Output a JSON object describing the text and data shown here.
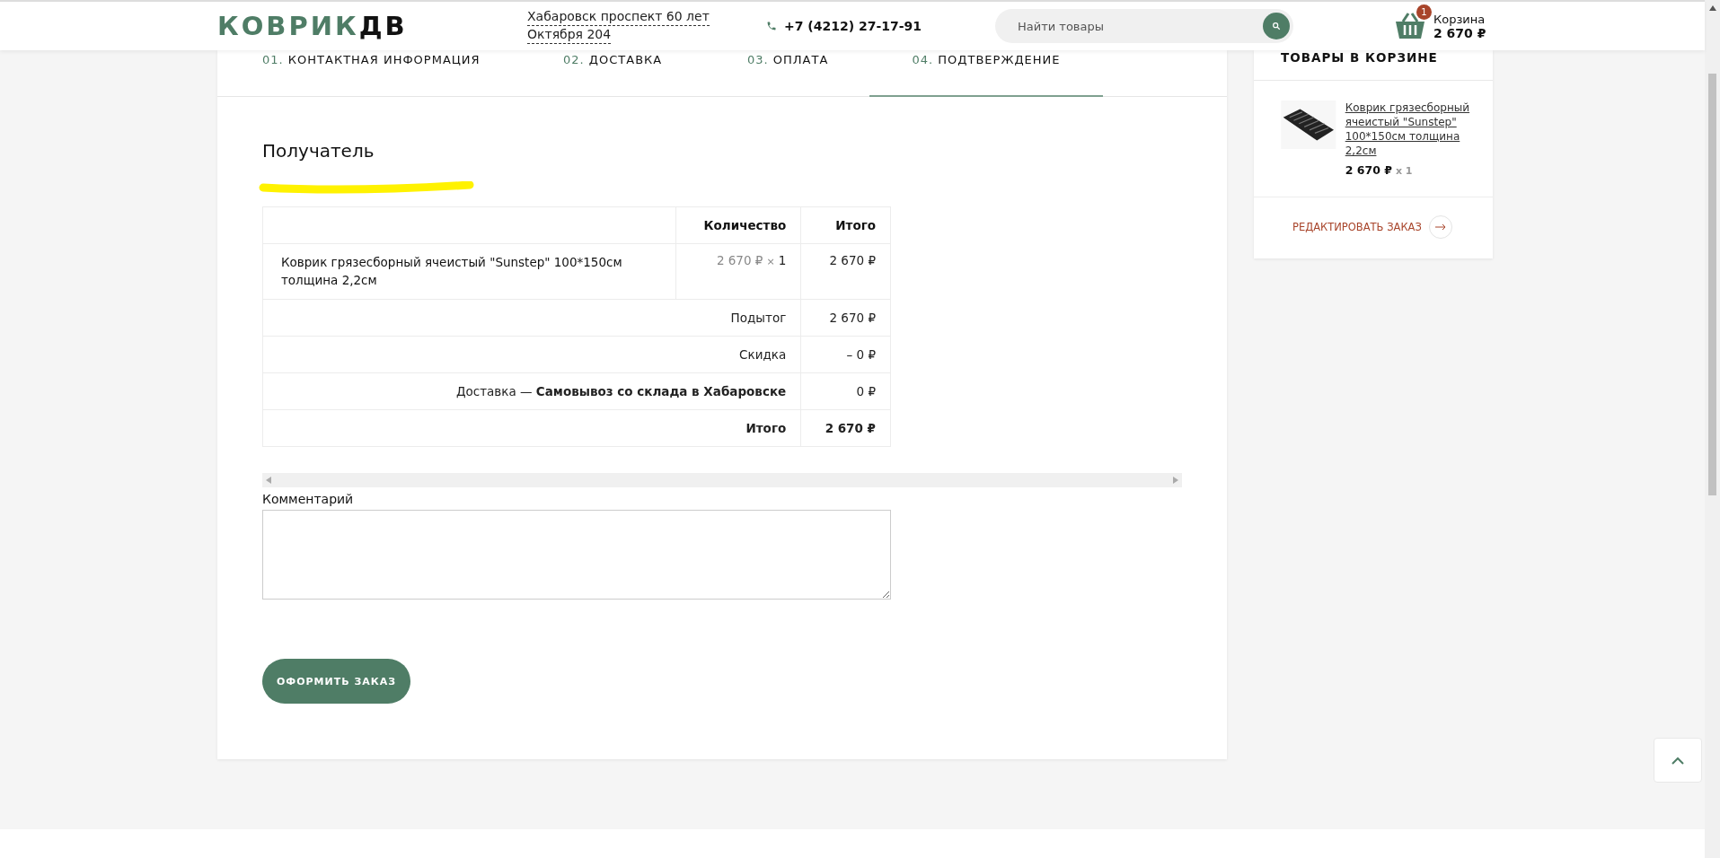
{
  "header": {
    "logo": {
      "part1": "КОВРИК",
      "part2": "ДВ"
    },
    "address": [
      "Хабаровск проспект 60 лет",
      "Октября 204"
    ],
    "phone": "+7 (4212) 27-17-91",
    "search": {
      "placeholder": "Найти товары"
    },
    "cart": {
      "badge": "1",
      "label": "Корзина",
      "total": "2 670 ₽"
    }
  },
  "steps": [
    {
      "number": "01.",
      "label": "КОНТАКТНАЯ ИНФОРМАЦИЯ",
      "selected": false
    },
    {
      "number": "02.",
      "label": "ДОСТАВКА",
      "selected": false
    },
    {
      "number": "03.",
      "label": "ОПЛАТА",
      "selected": false
    },
    {
      "number": "04.",
      "label": "ПОДТВЕРЖДЕНИЕ",
      "selected": true
    }
  ],
  "recipient": {
    "title": "Получатель"
  },
  "order_table": {
    "columns": [
      "Количество",
      "Итого"
    ],
    "item": {
      "name": "Коврик грязесборный ячеистый \"Sunstep\" 100*150см толщина 2,2см",
      "price": "2 670 ₽",
      "multiplier": "×",
      "qty": "1",
      "total": "2 670 ₽"
    },
    "summary": [
      {
        "kind": "line",
        "label": "Подытог",
        "value": "2 670 ₽"
      },
      {
        "kind": "line",
        "label": "Скидка",
        "value": "– 0 ₽"
      },
      {
        "kind": "line",
        "label": "Доставка — **Самовывоз со склада в Хабаровске**",
        "value": "0 ₽"
      },
      {
        "kind": "total",
        "label": "Итого",
        "value": "2 670 ₽"
      }
    ]
  },
  "comment": {
    "label": "Комментарий"
  },
  "submit": "ОФОРМИТЬ ЗАКАЗ",
  "sidebar": {
    "title": "ТОВАРЫ В КОРЗИНЕ",
    "items": [
      {
        "kind": "picture",
        "name": "Коврик грязесборный ячеистый \"Sunstep\" 100*150см толщина 2,2см",
        "price": "2 670 ₽",
        "qty": "x 1"
      }
    ],
    "edit_link": "РЕДАКТИРОВАТЬ ЗАКАЗ"
  }
}
